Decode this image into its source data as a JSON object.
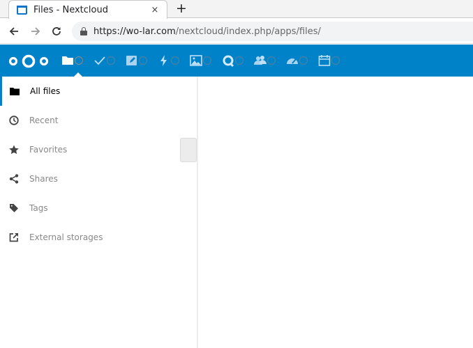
{
  "browser": {
    "tab": {
      "title": "Files - Nextcloud",
      "close_label": "×"
    },
    "new_tab_label": "+",
    "url": {
      "host": "https://wo-lar.com",
      "path": "/nextcloud/index.php/apps/files/"
    }
  },
  "header": {
    "logo": "nextcloud-logo",
    "accent_color": "#0082c9",
    "apps": [
      {
        "name": "Files",
        "icon": "folder-icon",
        "active": true
      },
      {
        "name": "Tasks",
        "icon": "checkmark-icon",
        "active": false
      },
      {
        "name": "Notes",
        "icon": "edit-note-icon",
        "active": false
      },
      {
        "name": "Activity",
        "icon": "lightning-icon",
        "active": false
      },
      {
        "name": "Gallery",
        "icon": "image-icon",
        "active": false
      },
      {
        "name": "Talk",
        "icon": "talk-icon",
        "active": false
      },
      {
        "name": "Contacts",
        "icon": "contacts-icon",
        "active": false
      },
      {
        "name": "Dashboard",
        "icon": "gauge-icon",
        "active": false
      },
      {
        "name": "Calendar",
        "icon": "calendar-icon",
        "active": false
      }
    ]
  },
  "sidebar": {
    "items": [
      {
        "label": "All files",
        "icon": "folder-icon",
        "active": true
      },
      {
        "label": "Recent",
        "icon": "clock-icon",
        "active": false
      },
      {
        "label": "Favorites",
        "icon": "star-icon",
        "active": false
      },
      {
        "label": "Shares",
        "icon": "share-icon",
        "active": false
      },
      {
        "label": "Tags",
        "icon": "tag-icon",
        "active": false
      },
      {
        "label": "External storages",
        "icon": "external-link-icon",
        "active": false
      }
    ]
  }
}
